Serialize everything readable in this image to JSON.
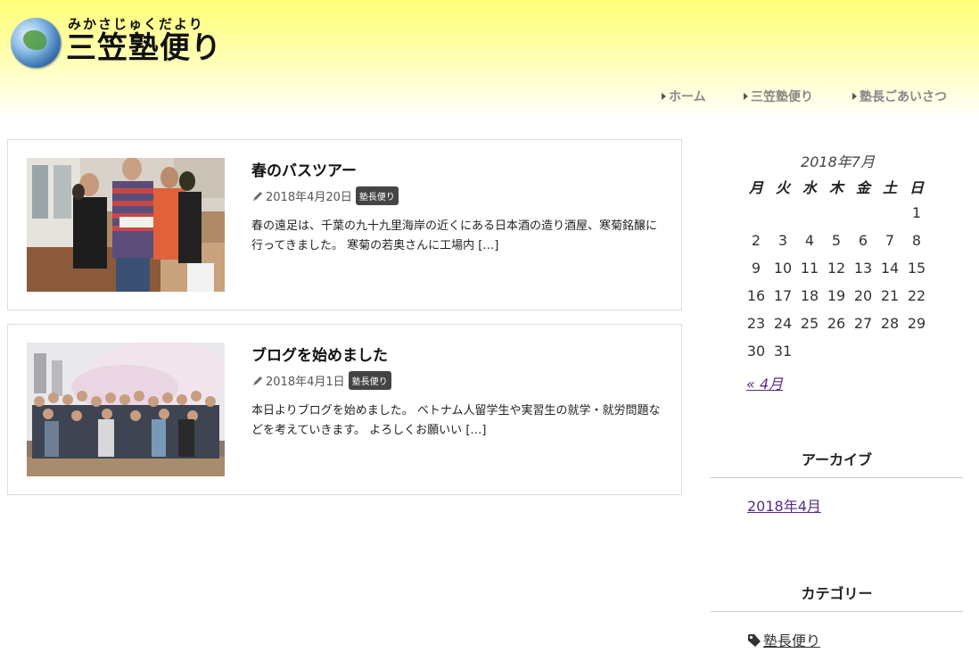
{
  "site": {
    "logo_ruby": "みかさじゅくだより",
    "logo_title": "三笠塾便り"
  },
  "nav": {
    "items": [
      {
        "label": "ホーム"
      },
      {
        "label": "三笠塾便り"
      },
      {
        "label": "塾長ごあいさつ"
      }
    ]
  },
  "posts": [
    {
      "title": "春のバスツアー",
      "date": "2018年4月20日",
      "category": "塾長便り",
      "excerpt": "春の遠足は、千葉の九十九里海岸の近くにある日本酒の造り酒屋、寒菊銘醸に行ってきました。 寒菊の若奥さんに工場内 […]"
    },
    {
      "title": "ブログを始めました",
      "date": "2018年4月1日",
      "category": "塾長便り",
      "excerpt": "本日よりブログを始めました。 ベトナム人留学生や実習生の就学・就労問題などを考えていきます。 よろしくお願いい […]"
    }
  ],
  "calendar": {
    "caption": "2018年7月",
    "weekdays": [
      "月",
      "火",
      "水",
      "木",
      "金",
      "土",
      "日"
    ],
    "rows": [
      [
        "",
        "",
        "",
        "",
        "",
        "",
        "1"
      ],
      [
        "2",
        "3",
        "4",
        "5",
        "6",
        "7",
        "8"
      ],
      [
        "9",
        "10",
        "11",
        "12",
        "13",
        "14",
        "15"
      ],
      [
        "16",
        "17",
        "18",
        "19",
        "20",
        "21",
        "22"
      ],
      [
        "23",
        "24",
        "25",
        "26",
        "27",
        "28",
        "29"
      ],
      [
        "30",
        "31",
        "",
        "",
        "",
        "",
        ""
      ]
    ],
    "prev_link": "« 4月"
  },
  "archive": {
    "title": "アーカイブ",
    "items": [
      "2018年4月"
    ]
  },
  "categories": {
    "title": "カテゴリー",
    "items": [
      "塾長便り"
    ]
  },
  "icons": {
    "nav_marker": "triangle-right-icon",
    "post_meta": "pencil-icon",
    "category": "tag-icon"
  },
  "colors": {
    "header_yellow": "#ffff77",
    "link_purple": "#5b2a86",
    "badge_bg": "#444444"
  }
}
